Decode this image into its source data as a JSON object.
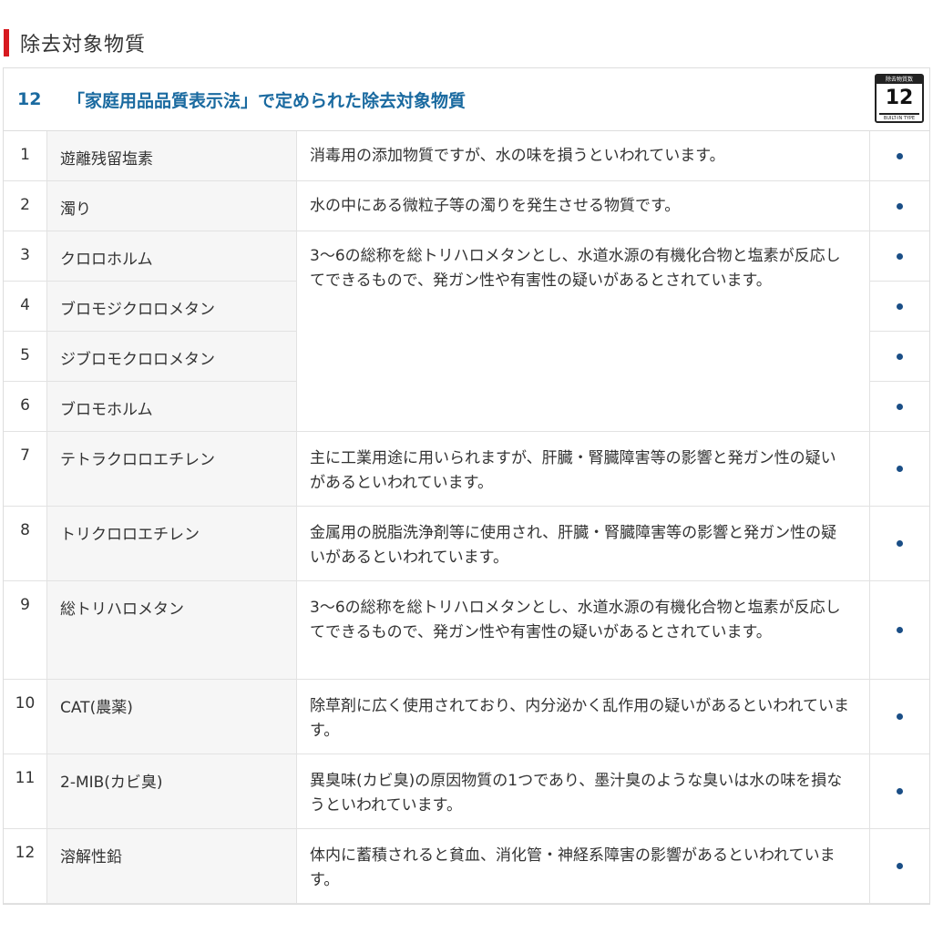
{
  "section": {
    "title": "除去対象物質"
  },
  "table": {
    "header_number": "12",
    "header_title": "「家庭用品品質表示法」で定められた除去対象物質",
    "badge": {
      "top_text": "除去物質数",
      "number": "12",
      "bottom_text": "BUILT-IN TYPE"
    }
  },
  "rows": [
    {
      "num": "1",
      "name": "遊離残留塩素",
      "desc": "消毒用の添加物質ですが、水の味を損うといわれています。",
      "mark": "●"
    },
    {
      "num": "2",
      "name": "濁り",
      "desc": "水の中にある微粒子等の濁りを発生させる物質です。",
      "mark": "●"
    },
    {
      "num": "3",
      "name": "クロロホルム",
      "mark": "●"
    },
    {
      "num": "4",
      "name": "ブロモジクロロメタン",
      "mark": "●"
    },
    {
      "num": "5",
      "name": "ジブロモクロロメタン",
      "mark": "●"
    },
    {
      "num": "6",
      "name": "ブロモホルム",
      "mark": "●"
    },
    {
      "num": "7",
      "name": "テトラクロロエチレン",
      "desc": "主に工業用途に用いられますが、肝臓・腎臓障害等の影響と発ガン性の疑いがあるといわれています。",
      "mark": "●"
    },
    {
      "num": "8",
      "name": "トリクロロエチレン",
      "desc": "金属用の脱脂洗浄剤等に使用され、肝臓・腎臓障害等の影響と発ガン性の疑いがあるといわれています。",
      "mark": "●"
    },
    {
      "num": "9",
      "name": "総トリハロメタン",
      "desc": "3〜6の総称を総トリハロメタンとし、水道水源の有機化合物と塩素が反応してできるもので、発ガン性や有害性の疑いがあるとされています。",
      "mark": "●"
    },
    {
      "num": "10",
      "name": "CAT(農薬)",
      "desc": "除草剤に広く使用されており、内分泌かく乱作用の疑いがあるといわれています。",
      "mark": "●"
    },
    {
      "num": "11",
      "name": "2-MIB(カビ臭)",
      "desc": "異臭味(カビ臭)の原因物質の1つであり、墨汁臭のような臭いは水の味を損なうといわれています。",
      "mark": "●"
    },
    {
      "num": "12",
      "name": "溶解性鉛",
      "desc": "体内に蓄積されると貧血、消化管・神経系障害の影響があるといわれています。",
      "mark": "●"
    }
  ],
  "merged_desc_3_6": "3〜6の総称を総トリハロメタンとし、水道水源の有機化合物と塩素が反応してできるもので、発ガン性や有害性の疑いがあるとされています。"
}
